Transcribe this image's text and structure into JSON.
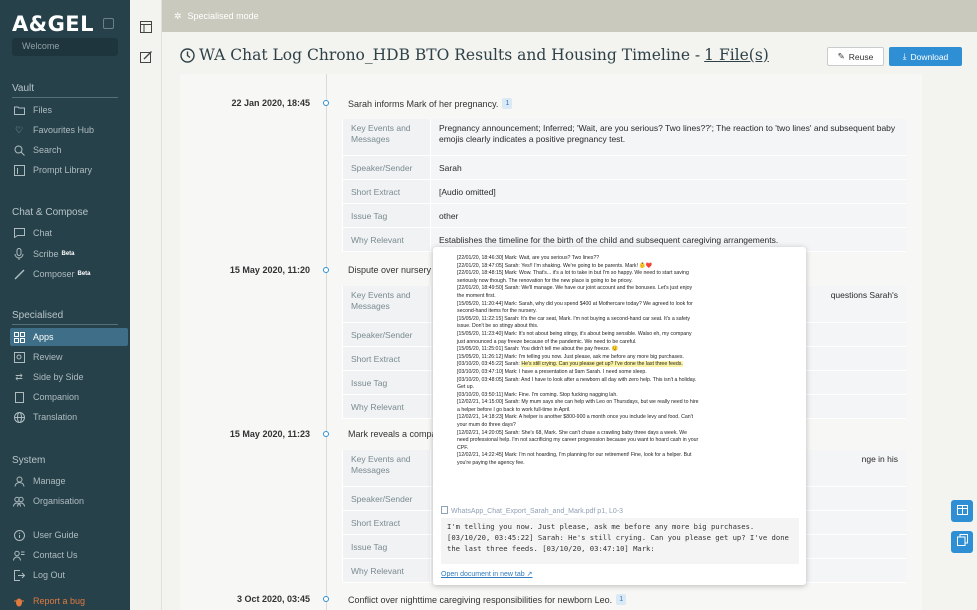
{
  "sidebar": {
    "logo": "A&GEL",
    "welcome": "Welcome",
    "sections": {
      "vault": "Vault",
      "chat_compose": "Chat & Compose",
      "specialised": "Specialised",
      "system": "System"
    },
    "vault_items": [
      "Files",
      "Favourites Hub",
      "Search",
      "Prompt Library"
    ],
    "chat_items": [
      "Chat",
      "Scribe",
      "Composer"
    ],
    "beta_label": "Beta",
    "specialised_items": [
      "Apps",
      "Review",
      "Side by Side",
      "Companion",
      "Translation"
    ],
    "system_items": [
      "Manage",
      "Organisation"
    ],
    "footer_items": [
      "User Guide",
      "Contact Us",
      "Log Out",
      "Report a bug"
    ]
  },
  "topbar": {
    "mode": "Specialised mode"
  },
  "header": {
    "title": "WA Chat Log Chrono_HDB BTO Results and Housing Timeline -",
    "files_link": "1 File(s)",
    "reuse_label": "Reuse",
    "download_label": "Download"
  },
  "labels": {
    "key_events": "Key Events and Messages",
    "speaker": "Speaker/Sender",
    "extract": "Short Extract",
    "issue_tag": "Issue Tag",
    "why_relevant": "Why Relevant"
  },
  "entries": [
    {
      "date": "22 Jan 2020, 18:45",
      "summary": "Sarah informs Mark of her pregnancy.",
      "cite": "1",
      "key_events": "Pregnancy announcement; Inferred; 'Wait, are you serious? Two lines??'; The reaction to 'two lines' and subsequent baby emojis clearly indicates a positive pregnancy test.",
      "speaker": "Sarah",
      "extract": "[Audio omitted]",
      "issue_tag": "other",
      "why_relevant": "Establishes the timeline for the birth of the child and subsequent caregiving arrangements."
    },
    {
      "date": "15 May 2020, 11:20",
      "summary": "Dispute over nursery",
      "key_events_tail": "questions Sarah's"
    },
    {
      "date": "15 May 2020, 11:23",
      "summary": "Mark reveals a compa",
      "key_events_tail": "nge in his"
    },
    {
      "date": "3 Oct 2020, 03:45",
      "summary": "Conflict over nighttime caregiving responsibilities for newborn Leo.",
      "cite": "1"
    }
  ],
  "popup": {
    "lines": [
      "[22/01/20, 18:46:30] Mark: Wait, are you serious? Two lines??",
      "[22/01/20, 18:47:05] Sarah: Yes!! I'm shaking. We're going to be parents. Mark! 👶❤️",
      "[22/01/20, 18:48:15] Mark: Wow. That's... it's a lot to take in but I'm so happy. We need to start saving",
      "seriously now though. The renovation for the new place is going to be pricey.",
      "[22/01/20, 18:49:50] Sarah: We'll manage. We have our joint account and the bonuses. Let's just enjoy",
      "the moment first.",
      "[15/05/20, 11:20:44] Mark: Sarah, why did you spend $400 at Mothercare today? We agreed to look for",
      "second-hand items for the nursery.",
      "[15/05/20, 11:22:15] Sarah: It's the car seat, Mark. I'm not buying a second-hand car seat. It's a safety",
      "issue. Don't be so stingy about this.",
      "[15/05/20, 11:23:40] Mark: It's not about being stingy, it's about being sensible. Walso eh, my company",
      "just announced a pay freeze because of the pandemic. We need to be careful.",
      "[15/05/20, 11:25:01] Sarah: You didn't tell me about the pay freeze. 😟",
      "[15/05/20, 11:26:12] Mark: I'm telling you now. Just please, ask me before any more big purchases.",
      "[03/10/20, 03:45:22] Sarah: He's still crying. Can you please get up? I've done the last three feeds.",
      "[03/10/20, 03:47:10] Mark: I have a presentation at 9am Sarah. I need some sleep.",
      "[03/10/20, 03:48:05] Sarah: And I have to look after a newborn all day with zero help. This isn't a holiday.",
      "Get up.",
      "[03/10/20, 03:50:11] Mark: Fine. I'm coming. Stop fucking nagging lah.",
      "[12/02/21, 14:15:00] Sarah: My mum says she can help with Leo on Thursdays, but we really need to hire",
      "a helper before I go back to work full-time in April.",
      "[12/02/21, 14:18:23] Mark: A helper is another $800-900 a month once you include levy and food. Can't",
      "your mum do three days?",
      "[12/02/21, 14:20:05] Sarah: She's 68, Mark. She can't chase a crawling baby three days a week. We",
      "need professional help. I'm not sacrificing my career progression because you want to hoard cash in your",
      "CPF.",
      "[12/02/21, 14:22:45] Mark: I'm not hoarding, I'm planning for our retirement! Fine, look for a helper. But",
      "you're paying the agency fee."
    ],
    "highlight_prefix": "[03/10/20, 03:45:22] Sarah: ",
    "highlight_text": "He's still crying. Can you please get up? I've done the last three feeds.",
    "file_ref": "WhatsApp_Chat_Export_Sarah_and_Mark.pdf  p1, L0-3",
    "quote": "I'm telling you now. Just please, ask me before any more big purchases. [03/10/20, 03:45:22] Sarah: He's still crying. Can you please get up? I've done the last three feeds. [03/10/20, 03:47:10] Mark:",
    "open_link": "Open document in new tab ↗"
  },
  "colors": {
    "sidebar_bg": "#27414a",
    "accent": "#2f8fd4",
    "active_nav": "#3f6f88",
    "report": "#e07a3e"
  }
}
